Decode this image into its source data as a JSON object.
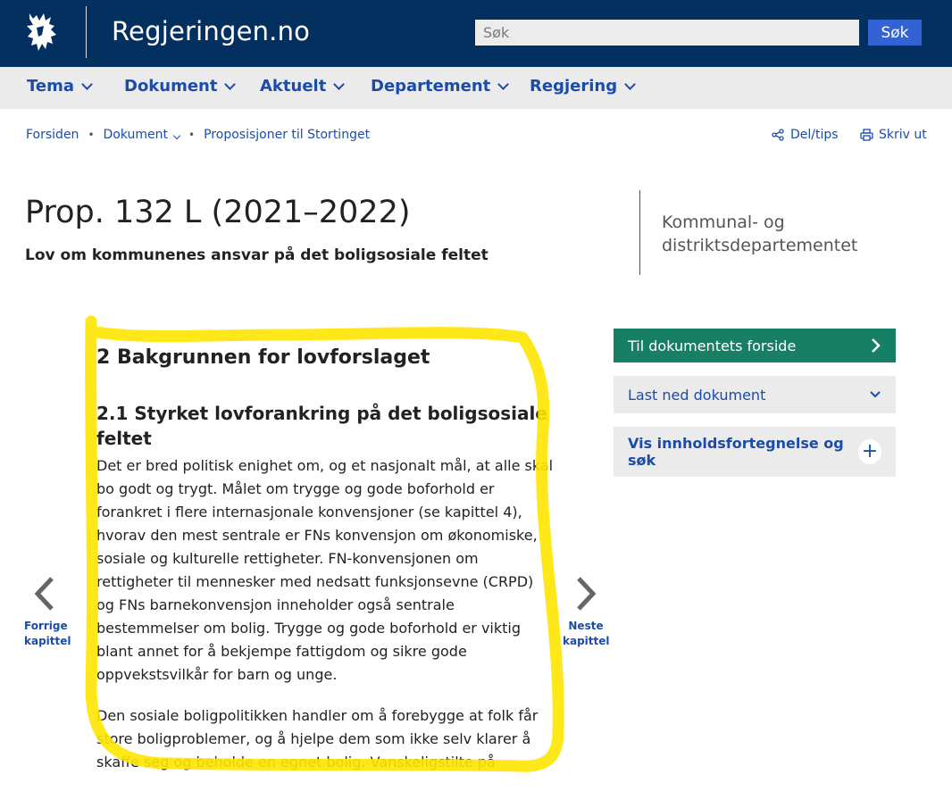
{
  "header": {
    "site_title": "Regjeringen.no",
    "search_placeholder": "Søk",
    "search_button": "Søk",
    "logo_icon": "norwegian-lion-icon"
  },
  "nav": {
    "items": [
      {
        "label": "Tema"
      },
      {
        "label": "Dokument"
      },
      {
        "label": "Aktuelt"
      },
      {
        "label": "Departement"
      },
      {
        "label": "Regjering"
      }
    ]
  },
  "breadcrumb": {
    "home": "Forsiden",
    "documents": "Dokument",
    "current": "Proposisjoner til Stortinget"
  },
  "tools": {
    "share": "Del/tips",
    "print": "Skriv ut"
  },
  "document": {
    "title": "Prop. 132 L (2021–2022)",
    "subtitle": "Lov om kommunenes ansvar på det boligsosiale feltet",
    "department": "Kommunal- og distriktsdepartementet"
  },
  "chapter_nav": {
    "prev_line1": "Forrige",
    "prev_line2": "kapittel",
    "next_line1": "Neste",
    "next_line2": "kapittel"
  },
  "content": {
    "heading": "2 Bakgrunnen for lovforslaget",
    "subheading": "2.1 Styrket lovforankring på det boligsosiale feltet",
    "paragraph1": "Det er bred politisk enighet om, og et nasjonalt mål, at alle skal bo godt og trygt. Målet om trygge og gode boforhold er forankret i flere internasjonale konvensjoner (se kapittel 4), hvorav den mest sentrale er FNs konvensjon om økonomiske, sosiale og kulturelle rettigheter. FN-konvensjonen om rettigheter til mennesker med nedsatt funksjonsevne (CRPD) og FNs barnekonvensjon inneholder også sentrale bestemmelser om bolig. Trygge og gode boforhold er viktig blant annet for å bekjempe fattigdom og sikre gode oppvekstsvilkår for barn og unge.",
    "paragraph2": "Den sosiale boligpolitikken handler om å forebygge at folk får store boligproblemer, og å hjelpe dem som ikke selv klarer å skaffe seg og beholde en egnet bolig. Vanskeligstilte på boligmarkedet er ikke en homogen gruppe, og mange av dem trenger hjelp på flere områder."
  },
  "sidebar": {
    "frontpage": "Til dokumentets forside",
    "download": "Last ned dokument",
    "toc": "Vis innholdsfortegnelse og søk"
  },
  "colors": {
    "header_bg": "#04305f",
    "link_blue": "#1a4cac",
    "green_button": "#178064",
    "highlight": "#ffe600"
  }
}
